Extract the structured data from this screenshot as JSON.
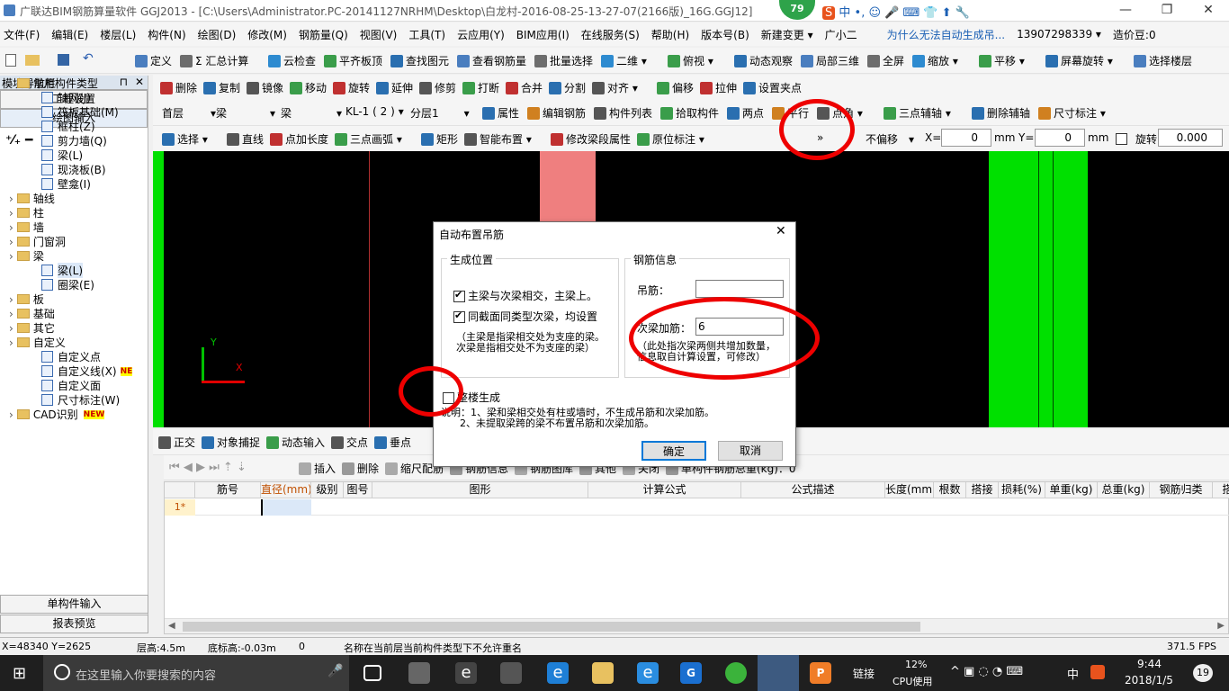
{
  "window": {
    "title": "广联达BIM钢筋算量软件 GGJ2013 - [C:\\Users\\Administrator.PC-20141127NRHM\\Desktop\\白龙村-2016-08-25-13-27-07(2166版)_16G.GGJ12]",
    "badge": "79"
  },
  "menu": [
    "文件(F)",
    "编辑(E)",
    "楼层(L)",
    "构件(N)",
    "绘图(D)",
    "修改(M)",
    "钢筋量(Q)",
    "视图(V)",
    "工具(T)",
    "云应用(Y)",
    "BIM应用(I)",
    "在线服务(S)",
    "帮助(H)",
    "版本号(B)",
    "新建变更 ▾",
    "广小二",
    "为什么无法自动生成吊...",
    "13907298339 ▾",
    "造价豆:0"
  ],
  "toolbar1": [
    "定义",
    "Σ 汇总计算",
    "云检查",
    "平齐板顶",
    "查找图元",
    "查看钢筋量",
    "批量选择",
    "二维 ▾",
    "俯视 ▾",
    "动态观察",
    "局部三维",
    "全屏",
    "缩放 ▾",
    "平移 ▾",
    "屏幕旋转 ▾",
    "选择楼层"
  ],
  "toolbar2": [
    "删除",
    "复制",
    "镜像",
    "移动",
    "旋转",
    "延伸",
    "修剪",
    "打断",
    "合并",
    "分割",
    "对齐 ▾",
    "偏移",
    "拉伸",
    "设置夹点"
  ],
  "toolbar3": {
    "floor": "首层",
    "type": "梁",
    "subtype": "梁",
    "component": "KL-1 ( 2 )",
    "layer": "分层1",
    "buttons": [
      "属性",
      "编辑钢筋",
      "构件列表",
      "拾取构件",
      "两点",
      "平行",
      "点角 ▾",
      "三点辅轴 ▾",
      "删除辅轴",
      "尺寸标注 ▾"
    ]
  },
  "toolbar4": {
    "buttons": [
      "选择 ▾",
      "直线",
      "点加长度",
      "三点画弧 ▾",
      "矩形",
      "智能布置 ▾",
      "修改梁段属性",
      "原位标注 ▾"
    ],
    "offset": "不偏移",
    "x_label": "X=",
    "x_value": "0",
    "y_label": "Y=",
    "y_value": "0",
    "mm": "mm",
    "rotate_label": "旋转",
    "rotate_value": "0.000"
  },
  "nav": {
    "header": "模块导航栏",
    "btn_project": "工程设置",
    "btn_draw": "绘图输入",
    "btn_single": "单构件输入",
    "btn_report": "报表预览",
    "tree": [
      {
        "label": "常用构件类型",
        "level": 0,
        "kind": "folder"
      },
      {
        "label": "轴网(J)",
        "level": 1,
        "kind": "leaf"
      },
      {
        "label": "筏板基础(M)",
        "level": 1,
        "kind": "leaf"
      },
      {
        "label": "框柱(Z)",
        "level": 1,
        "kind": "leaf"
      },
      {
        "label": "剪力墙(Q)",
        "level": 1,
        "kind": "leaf"
      },
      {
        "label": "梁(L)",
        "level": 1,
        "kind": "leaf"
      },
      {
        "label": "现浇板(B)",
        "level": 1,
        "kind": "leaf"
      },
      {
        "label": "壁龛(I)",
        "level": 1,
        "kind": "leaf"
      },
      {
        "label": "轴线",
        "level": 0,
        "kind": "folder"
      },
      {
        "label": "柱",
        "level": 0,
        "kind": "folder"
      },
      {
        "label": "墙",
        "level": 0,
        "kind": "folder"
      },
      {
        "label": "门窗洞",
        "level": 0,
        "kind": "folder"
      },
      {
        "label": "梁",
        "level": 0,
        "kind": "folder"
      },
      {
        "label": "梁(L)",
        "level": 1,
        "kind": "leaf"
      },
      {
        "label": "圈梁(E)",
        "level": 1,
        "kind": "leaf"
      },
      {
        "label": "板",
        "level": 0,
        "kind": "folder"
      },
      {
        "label": "基础",
        "level": 0,
        "kind": "folder"
      },
      {
        "label": "其它",
        "level": 0,
        "kind": "folder"
      },
      {
        "label": "自定义",
        "level": 0,
        "kind": "folder"
      },
      {
        "label": "自定义点",
        "level": 1,
        "kind": "leaf"
      },
      {
        "label": "自定义线(X)",
        "level": 1,
        "kind": "leaf"
      },
      {
        "label": "自定义面",
        "level": 1,
        "kind": "leaf"
      },
      {
        "label": "尺寸标注(W)",
        "level": 1,
        "kind": "leaf"
      },
      {
        "label": "CAD识别",
        "level": 0,
        "kind": "folder"
      }
    ],
    "new_badge": "NEW",
    "ne_badge": "NE"
  },
  "canvas": {
    "axis_x": "X",
    "axis_y": "Y"
  },
  "snapbar": [
    "正交",
    "对象捕捉",
    "动态输入",
    "交点",
    "垂点"
  ],
  "gridtoolbar": [
    "插入",
    "删除",
    "缩尺配筋",
    "钢筋信息",
    "钢筋图库",
    "其他",
    "关闭",
    "单构件钢筋总重(kg)：0"
  ],
  "grid": {
    "headers": [
      "",
      "筋号",
      "直径(mm)",
      "级别",
      "图号",
      "图形",
      "计算公式",
      "公式描述",
      "长度(mm)",
      "根数",
      "搭接",
      "损耗(%)",
      "单重(kg)",
      "总重(kg)",
      "钢筋归类",
      "搭接形"
    ],
    "row_label": "1*"
  },
  "dialog": {
    "title": "自动布置吊筋",
    "group1": "生成位置",
    "opt1": "主梁与次梁相交，主梁上。",
    "opt2": "同截面同类型次梁，均设置",
    "note1": "（主梁是指梁相交处为支座的梁。\n次梁是指相交处不为支座的梁）",
    "group2": "钢筋信息",
    "label_hanger": "吊筋：",
    "hanger_value": "",
    "label_extra": "次梁加筋：",
    "extra_value": "6",
    "note2": "（此处指次梁两侧共增加数量，\n信息取自计算设置，可修改）",
    "whole_floor": "整楼生成",
    "explain": "说明：1、梁和梁相交处有柱或墙时，不生成吊筋和次梁加筋。\n      2、未提取梁跨的梁不布置吊筋和次梁加筋。",
    "ok": "确定",
    "cancel": "取消",
    "opt1_checked": true,
    "opt2_checked": true,
    "whole_checked": false
  },
  "status": {
    "coords": "X=48340 Y=2625",
    "floor_height": "层高:4.5m",
    "bottom": "底标高:-0.03m",
    "zero": "0",
    "message": "名称在当前层当前构件类型下不允许重名",
    "fps": "371.5 FPS"
  },
  "taskbar": {
    "search_placeholder": "在这里输入你要搜索的内容",
    "link": "链接",
    "cpu_pct": "12%",
    "cpu_label": "CPU使用",
    "ime": "中",
    "time": "9:44",
    "date": "2018/1/5",
    "notif": "19"
  },
  "colors": {
    "accent": "#0078d7",
    "green": "#00e000",
    "pink": "#ef7f7f",
    "annotation": "#e00000"
  }
}
